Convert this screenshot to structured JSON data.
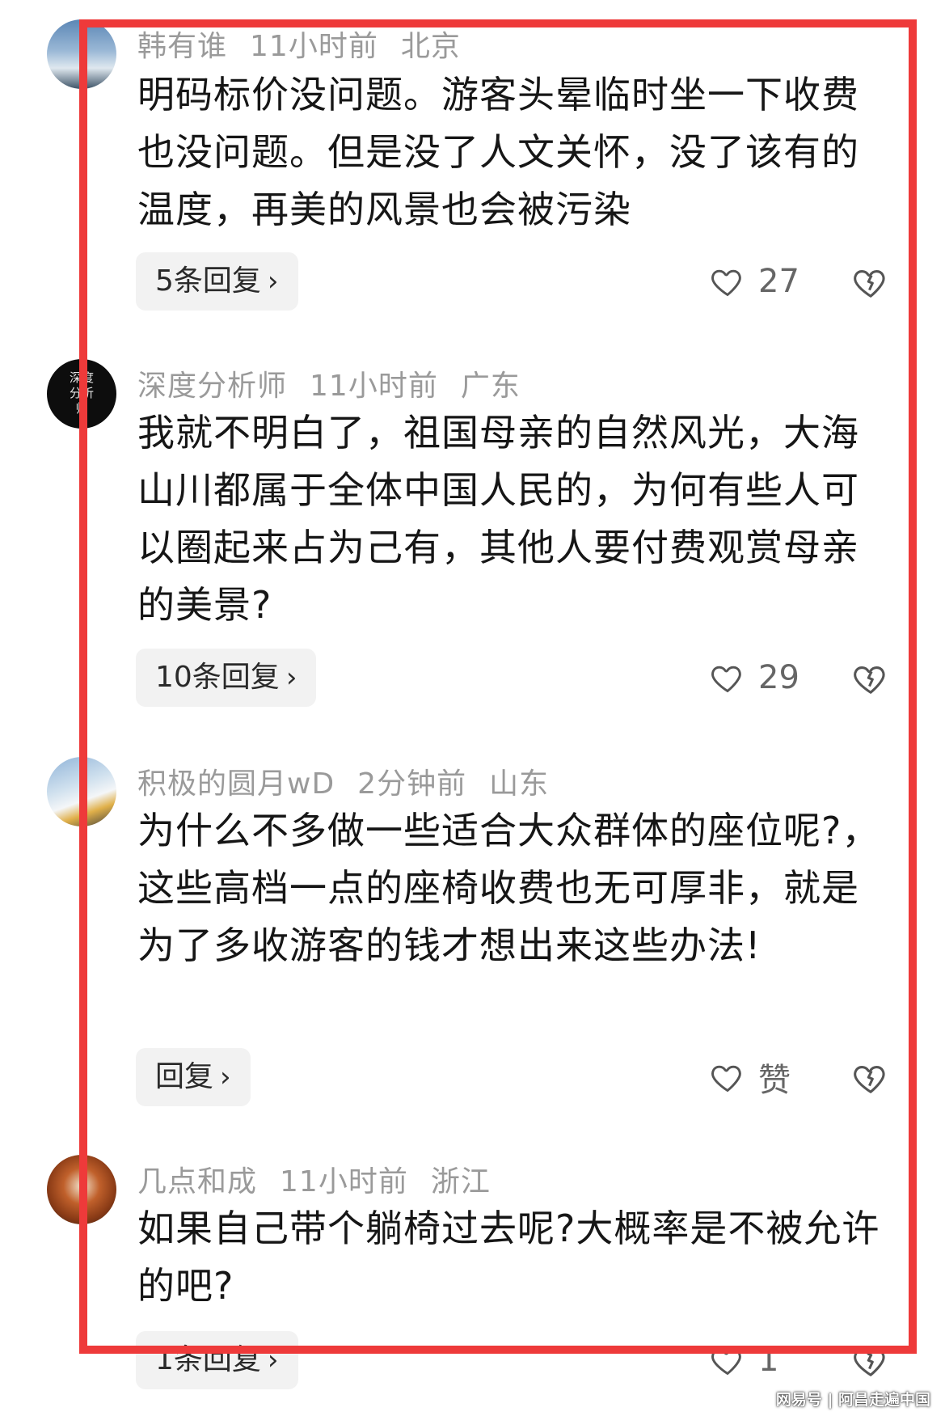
{
  "comments": [
    {
      "username": "韩有谁",
      "time": "11小时前",
      "location": "北京",
      "text": "明码标价没问题。游客头晕临时坐一下收费也没问题。但是没了人文关怀，没了该有的温度，再美的风景也会被污染",
      "reply_label": "5条回复",
      "like_count": "27"
    },
    {
      "username": "深度分析师",
      "time": "11小时前",
      "location": "广东",
      "text": "我就不明白了，祖国母亲的自然风光，大海山川都属于全体中国人民的，为何有些人可以圈起来占为己有，其他人要付费观赏母亲的美景?",
      "reply_label": "10条回复",
      "like_count": "29",
      "avatar_text": "深度分析师"
    },
    {
      "username": "积极的圆月wD",
      "time": "2分钟前",
      "location": "山东",
      "text": "为什么不多做一些适合大众群体的座位呢?，这些高档一点的座椅收费也无可厚非，就是为了多收游客的钱才想出来这些办法!",
      "reply_label": "回复",
      "like_count": "赞"
    },
    {
      "username": "几点和成",
      "time": "11小时前",
      "location": "浙江",
      "text": "如果自己带个躺椅过去呢?大概率是不被允许的吧?",
      "reply_label": "1条回复",
      "like_count": "1"
    }
  ],
  "icons": {
    "like": "heart-outline-icon",
    "dislike": "broken-heart-icon",
    "reply_chevron": "chevron-right-icon"
  },
  "colors": {
    "frame": "#ee3a3a",
    "meta_text": "#9a9a9a",
    "body_text": "#161616",
    "reply_bg": "#f2f2f2"
  },
  "watermark": "网易号 | 阿昌走遍中国"
}
